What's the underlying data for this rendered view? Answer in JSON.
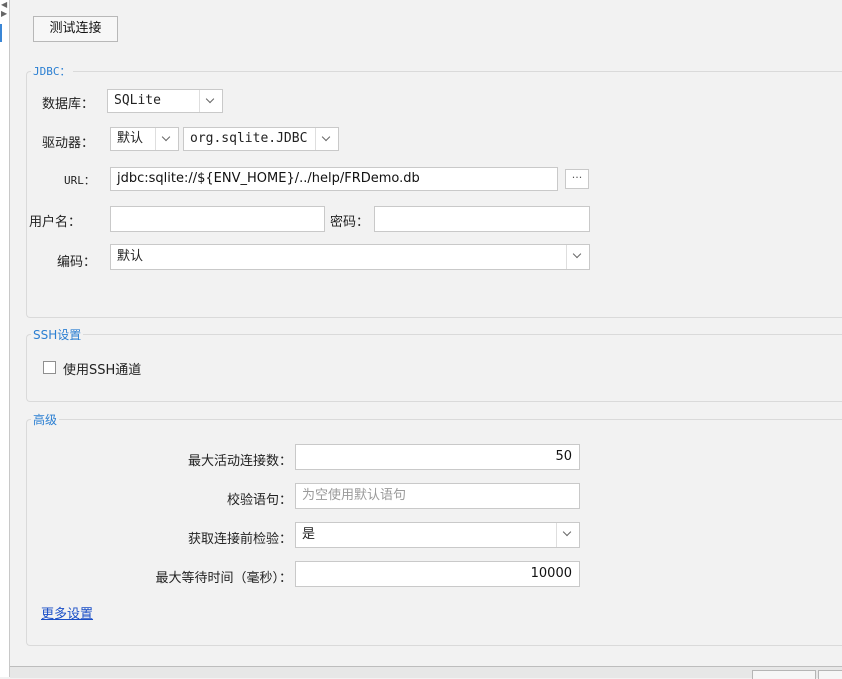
{
  "toolbar": {
    "test_connection_label": "测试连接"
  },
  "jdbc": {
    "legend": "JDBC：",
    "database": {
      "label": "数据库：",
      "value": "SQLite"
    },
    "driver": {
      "label": "驱动器：",
      "mode_value": "默认",
      "class_value": "org.sqlite.JDBC"
    },
    "url": {
      "label": "URL：",
      "value": "jdbc:sqlite://${ENV_HOME}/../help/FRDemo.db",
      "browse_label": "···"
    },
    "username": {
      "label": "用户名：",
      "value": ""
    },
    "password": {
      "label": "密码：",
      "value": ""
    },
    "encoding": {
      "label": "编码：",
      "value": "默认"
    }
  },
  "ssh": {
    "legend": "SSH设置",
    "use_tunnel_label": "使用SSH通道",
    "checked": false
  },
  "advanced": {
    "legend": "高级",
    "max_active": {
      "label": "最大活动连接数：",
      "value": "50"
    },
    "validation_query": {
      "label": "校验语句：",
      "placeholder": "为空使用默认语句"
    },
    "test_before": {
      "label": "获取连接前检验：",
      "value": "是"
    },
    "max_wait": {
      "label": "最大等待时间（毫秒）：",
      "value": "10000"
    },
    "more_settings_label": "更多设置"
  },
  "colors": {
    "legend_blue": "#2b7fd2",
    "link_blue": "#1a4fc7",
    "background": "#f2f2f2"
  }
}
